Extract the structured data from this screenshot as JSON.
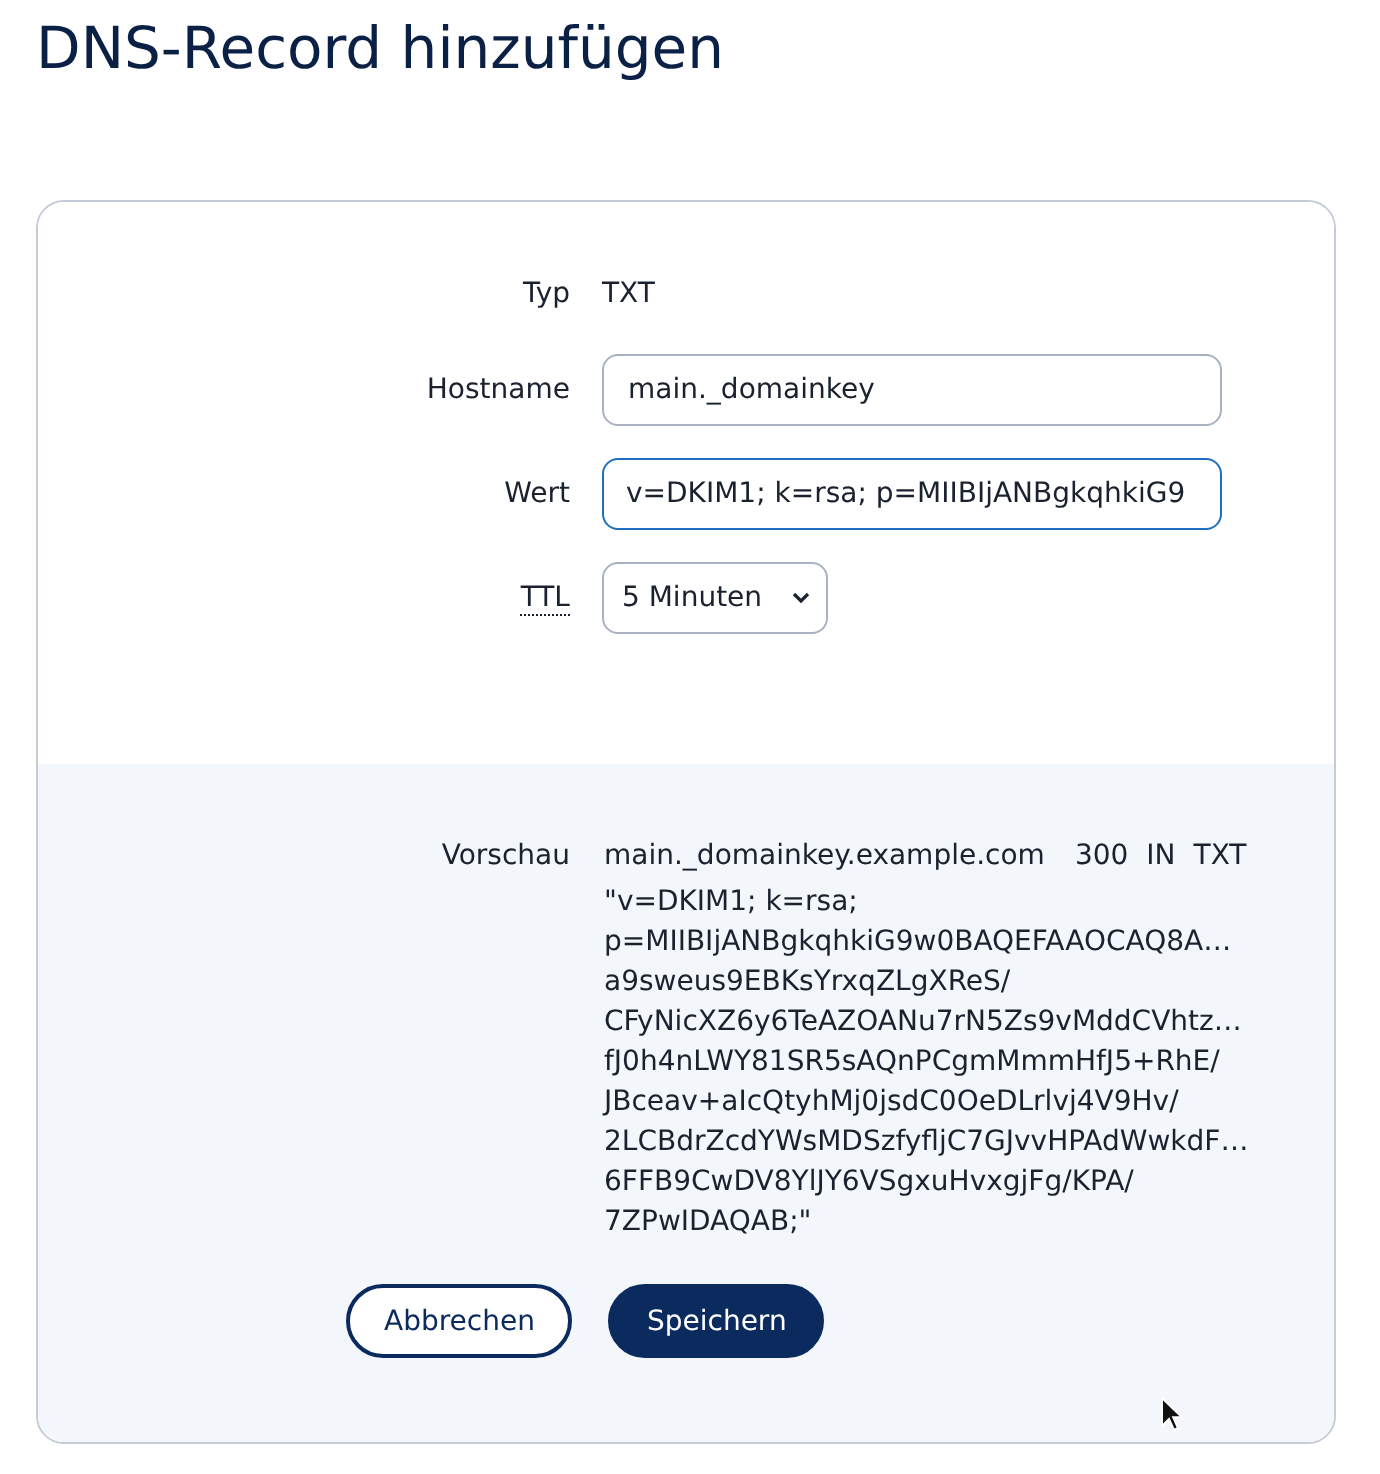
{
  "title": "DNS-Record hinzufügen",
  "form": {
    "fields": [
      {
        "kind": "static",
        "label": "Typ",
        "value": "TXT"
      },
      {
        "kind": "input",
        "label": "Hostname",
        "value": "main._domainkey",
        "focused": false
      },
      {
        "kind": "input",
        "label": "Wert",
        "value": "v=DKIM1; k=rsa; p=MIIBIjANBgkqhkiG9",
        "focused": true
      },
      {
        "kind": "select",
        "label": "TTL",
        "value": "5 Minuten",
        "abbr": true
      }
    ]
  },
  "preview": {
    "label": "Vorschau",
    "name": "main._domainkey.example.com",
    "ttl": "300",
    "class": "IN",
    "type": "TXT",
    "lines": [
      "\"v=DKIM1; k=rsa;",
      "p=MIIBIjANBgkqhkiG9w0BAQEFAAOCAQ8A…",
      "a9sweus9EBKsYrxqZLgXReS/",
      "CFyNicXZ6y6TeAZOANu7rN5Zs9vMddCVhtz…",
      "fJ0h4nLWY81SR5sAQnPCgmMmmHfJ5+RhE/",
      "JBceav+aIcQtyhMj0jsdC0OeDLrlvj4V9Hv/",
      "2LCBdrZcdYWsMDSzfyfljC7GJvvHPAdWwkdF…",
      "6FFB9CwDV8YlJY6VSgxuHvxgjFg/KPA/",
      "7ZPwIDAQAB;\""
    ]
  },
  "buttons": [
    {
      "kind": "secondary",
      "label": "Abbrechen"
    },
    {
      "kind": "primary",
      "label": "Speichern"
    }
  ]
}
